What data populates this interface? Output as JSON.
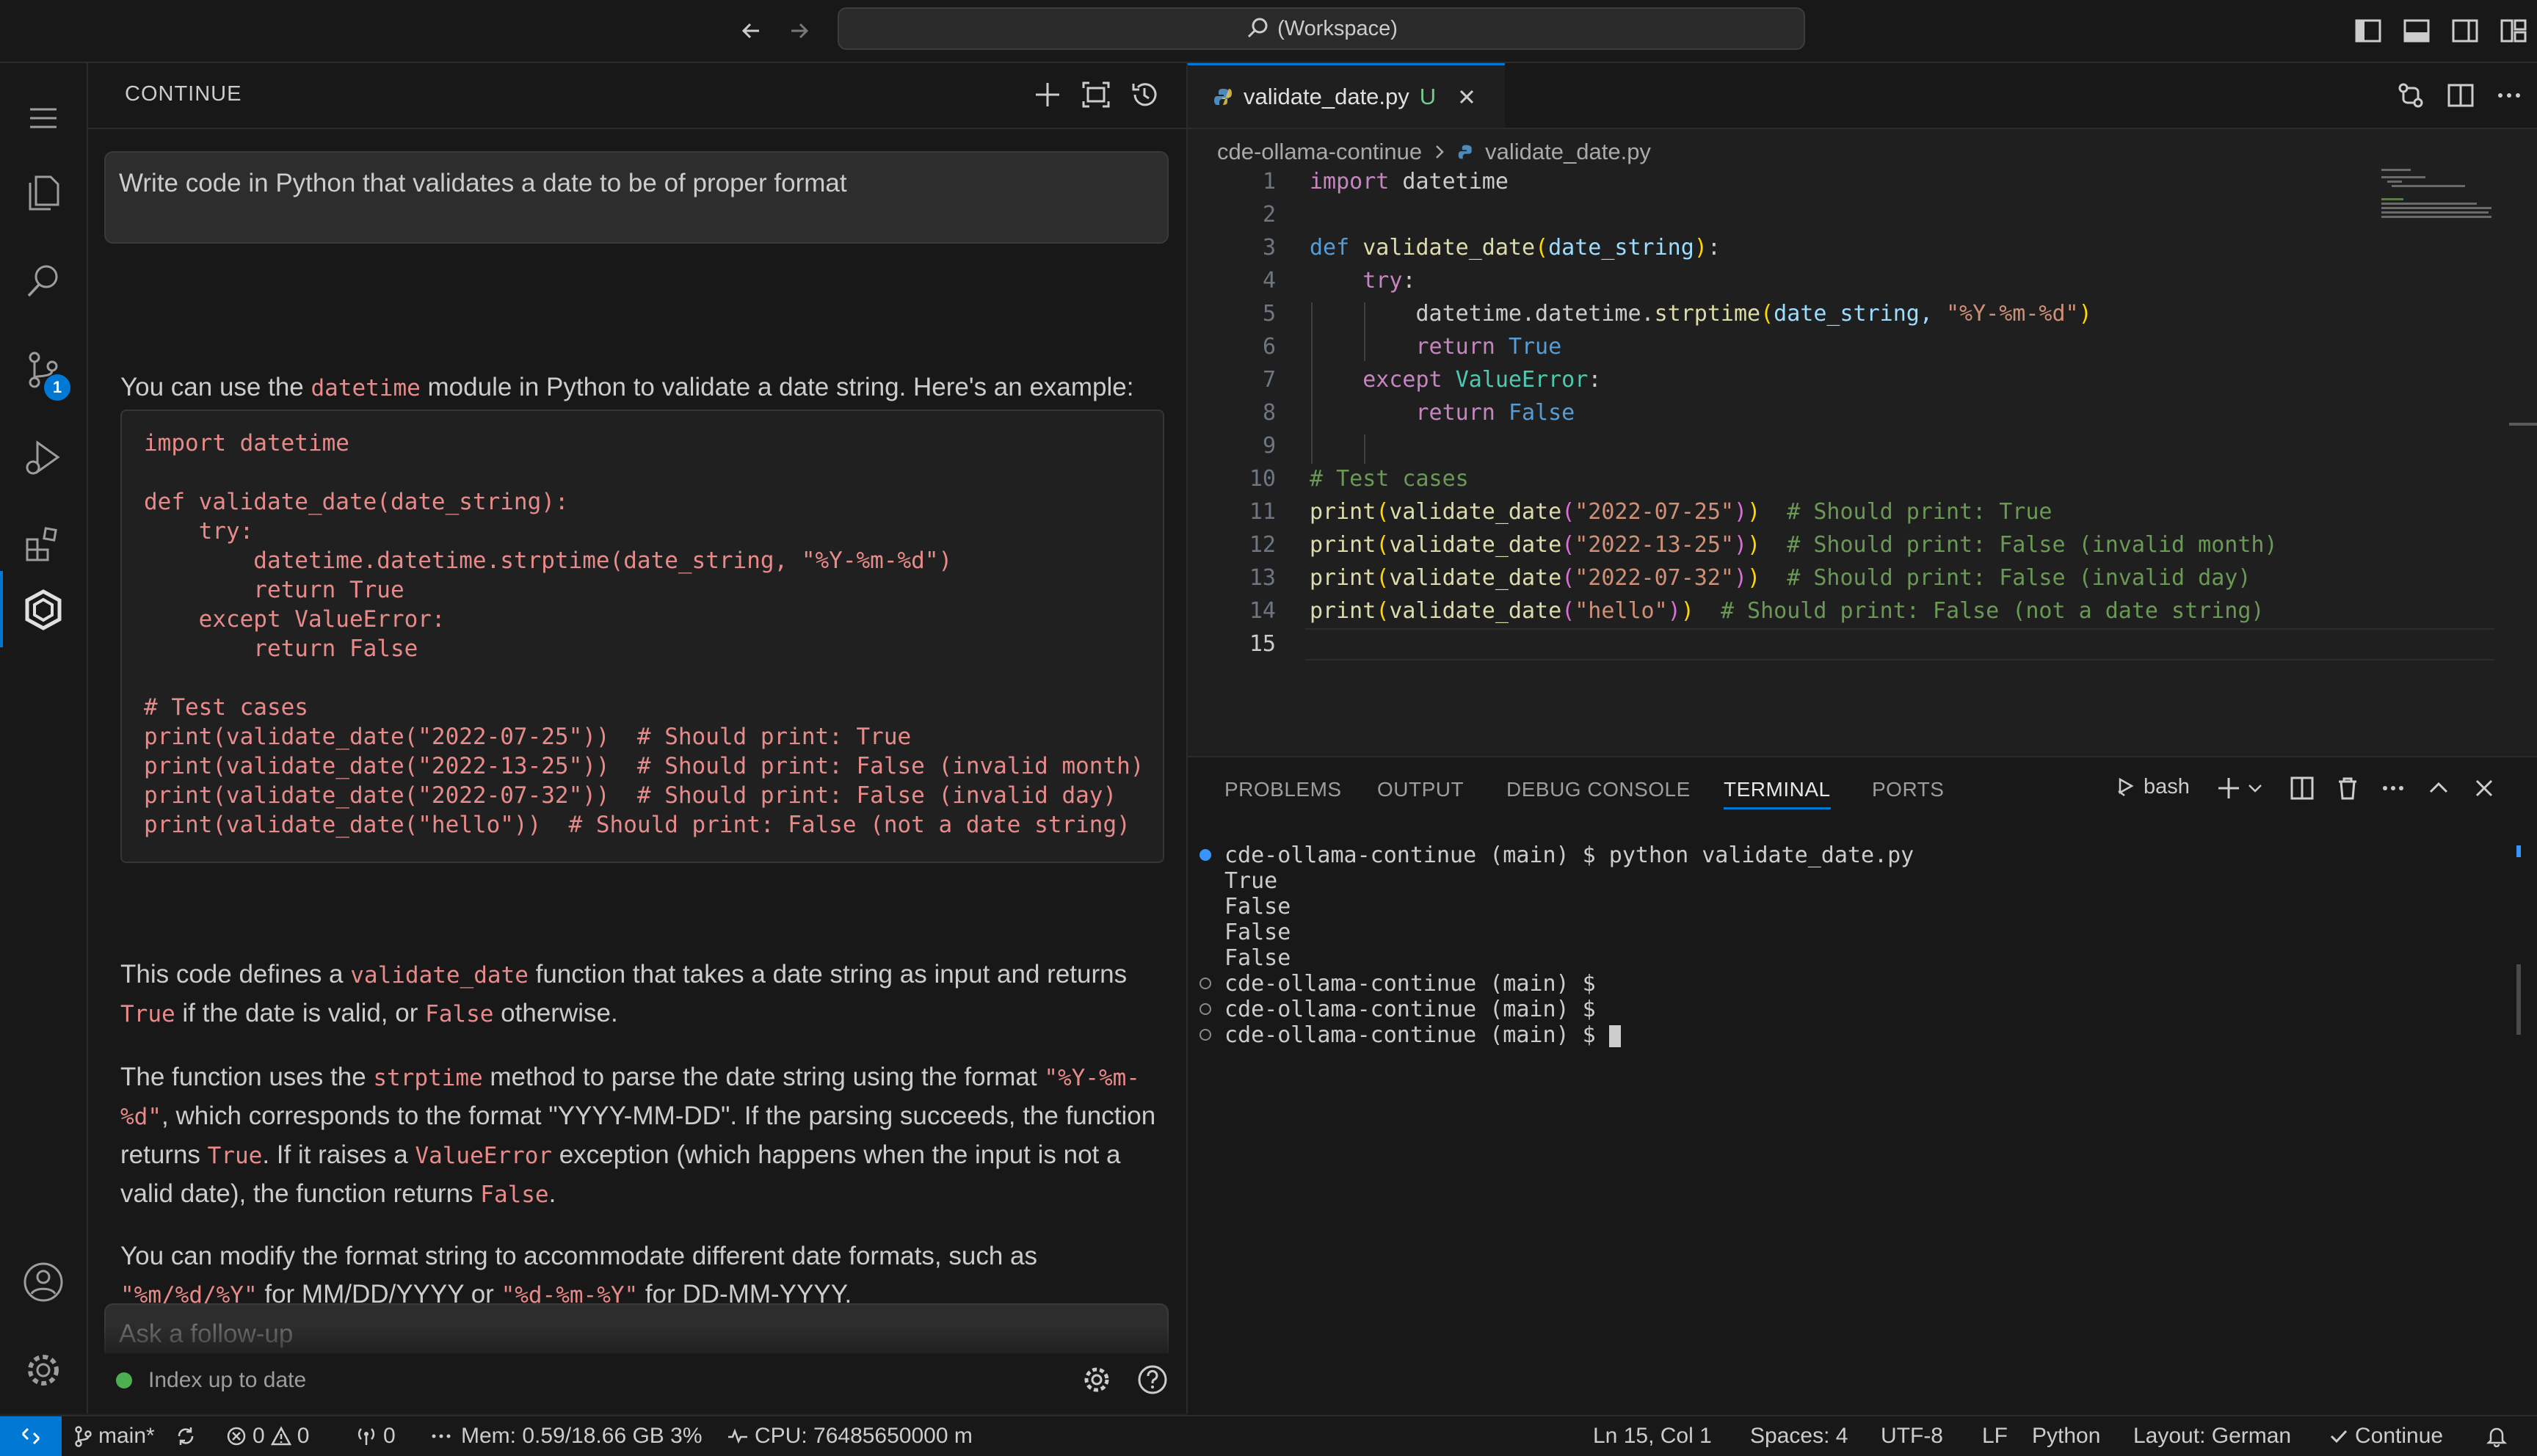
{
  "titlebar": {
    "search_label": "(Workspace)"
  },
  "activity": {
    "scm_badge": "1"
  },
  "continue": {
    "header_title": "CONTINUE",
    "prompt": "Write code in Python that validates a date to be of proper format",
    "response": {
      "p1_a": "You can use the ",
      "p1_code": "datetime",
      "p1_b": " module in Python to validate a date string. Here's an example:",
      "code": "import datetime\n\ndef validate_date(date_string):\n    try:\n        datetime.datetime.strptime(date_string, \"%Y-%m-%d\")\n        return True\n    except ValueError:\n        return False\n\n# Test cases\nprint(validate_date(\"2022-07-25\"))  # Should print: True\nprint(validate_date(\"2022-13-25\"))  # Should print: False (invalid month)\nprint(validate_date(\"2022-07-32\"))  # Should print: False (invalid day)\nprint(validate_date(\"hello\"))  # Should print: False (not a date string)",
      "p2_a": "This code defines a ",
      "p2_code1": "validate_date",
      "p2_b": " function that takes a date string as input and returns ",
      "p2_code2": "True",
      "p2_c": " if the date is valid, or ",
      "p2_code3": "False",
      "p2_d": " otherwise.",
      "p3_a": "The function uses the ",
      "p3_code1": "strptime",
      "p3_b": " method to parse the date string using the format ",
      "p3_code2": "\"%Y-%m-%d\"",
      "p3_c": ", which corresponds to the format \"YYYY-MM-DD\". If the parsing succeeds, the function returns ",
      "p3_code3": "True",
      "p3_d": ". If it raises a ",
      "p3_code4": "ValueError",
      "p3_e": " exception (which happens when the input is not a valid date), the function returns ",
      "p3_code5": "False",
      "p3_f": ".",
      "p4_a": "You can modify the format string to accommodate different date formats, such as ",
      "p4_code1": "\"%m/%d/%Y\"",
      "p4_b": " for MM/DD/YYYY or ",
      "p4_code2": "\"%d-%m-%Y\"",
      "p4_c": " for DD-MM-YYYY."
    },
    "followup_placeholder": "Ask a follow-up",
    "index_status": "Index up to date"
  },
  "editor": {
    "tab_name": "validate_date.py",
    "tab_status": "U",
    "breadcrumb_folder": "cde-ollama-continue",
    "breadcrumb_file": "validate_date.py",
    "line_numbers": [
      "1",
      "2",
      "3",
      "4",
      "5",
      "6",
      "7",
      "8",
      "9",
      "10",
      "11",
      "12",
      "13",
      "14",
      "15"
    ],
    "code": {
      "l1_kw": "import",
      "l1_mod": " datetime",
      "l3_kw": "def",
      "l3_fn": "validate_date",
      "l3_param": "date_string",
      "l4_kw": "try",
      "l5_a": "datetime.datetime.",
      "l5_fn": "strptime",
      "l5_b": "date_string, ",
      "l5_str": "\"%Y-%m-%d\"",
      "l6_kw": "return",
      "l6_val": "True",
      "l7_kw": "except",
      "l7_cls": "ValueError",
      "l8_kw": "return",
      "l8_val": "False",
      "l10_cm": "# Test cases",
      "l11_fn": "print",
      "l11_fn2": "validate_date",
      "l11_str": "\"2022-07-25\"",
      "l11_cm": "# Should print: True",
      "l12_fn": "print",
      "l12_fn2": "validate_date",
      "l12_str": "\"2022-13-25\"",
      "l12_cm": "# Should print: False (invalid month)",
      "l13_fn": "print",
      "l13_fn2": "validate_date",
      "l13_str": "\"2022-07-32\"",
      "l13_cm": "# Should print: False (invalid day)",
      "l14_fn": "print",
      "l14_fn2": "validate_date",
      "l14_str": "\"hello\"",
      "l14_cm": "# Should print: False (not a date string)"
    }
  },
  "panel": {
    "tabs": [
      "PROBLEMS",
      "OUTPUT",
      "DEBUG CONSOLE",
      "TERMINAL",
      "PORTS"
    ],
    "active_tab": "TERMINAL",
    "shell": "bash",
    "terminal_lines": [
      "cde-ollama-continue (main) $ python validate_date.py",
      "True",
      "False",
      "False",
      "False",
      "cde-ollama-continue (main) $",
      "cde-ollama-continue (main) $",
      "cde-ollama-continue (main) $ "
    ]
  },
  "statusbar": {
    "branch": "main*",
    "errors": "0",
    "warnings": "0",
    "ports": "0",
    "mem": "Mem: 0.59/18.66 GB 3%",
    "cpu": "CPU: 76485650000 m",
    "position": "Ln 15, Col 1",
    "spaces": "Spaces: 4",
    "encoding": "UTF-8",
    "eol": "LF",
    "language": "Python",
    "layout": "Layout: German",
    "continue": "Continue"
  },
  "colors": {
    "accent": "#0078d4",
    "inline_code": "#e88a8a",
    "index_dot": "#4caf50"
  }
}
